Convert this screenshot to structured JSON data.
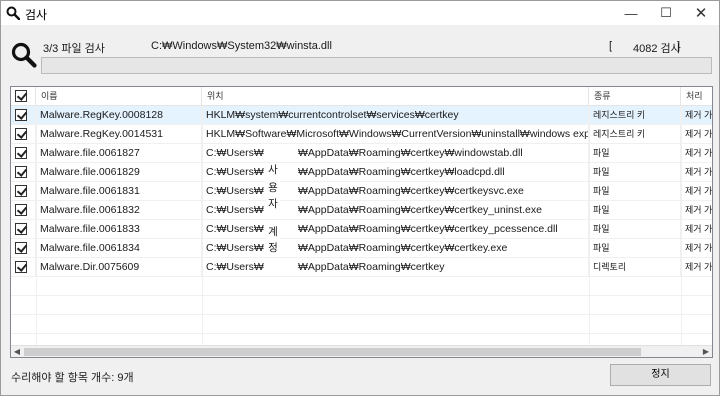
{
  "window": {
    "title": "검사",
    "min_glyph": "—",
    "max_glyph": "☐",
    "close_glyph": "✕"
  },
  "scan": {
    "progress_label": "3/3 파일 검사",
    "current_path": "C:₩Windows₩System32₩winsta.dll",
    "count_open": "[",
    "count_value": "4082 검사",
    "count_close": "]",
    "progress_percent": 0
  },
  "table": {
    "columns": [
      "이름",
      "위치",
      "종류",
      "처리"
    ],
    "rows": [
      {
        "checked": true,
        "selected": true,
        "name": "Malware.RegKey.0008128",
        "location": "HKLM₩system₩currentcontrolset₩services₩certkey",
        "type": "레지스트리 키",
        "action": "제거 가"
      },
      {
        "checked": true,
        "selected": false,
        "name": "Malware.RegKey.0014531",
        "location": "HKLM₩Software₩Microsoft₩Windows₩CurrentVersion₩uninstall₩windows explorer plu...",
        "type": "레지스트리 키",
        "action": "제거 가"
      },
      {
        "checked": true,
        "selected": false,
        "name": "Malware.file.0061827",
        "location_prefix": "C:₩Users₩",
        "location_suffix": "₩AppData₩Roaming₩certkey₩windowstab.dll",
        "type": "파일",
        "action": "제거 가"
      },
      {
        "checked": true,
        "selected": false,
        "name": "Malware.file.0061829",
        "location_prefix": "C:₩Users₩",
        "location_suffix": "₩AppData₩Roaming₩certkey₩loadcpd.dll",
        "type": "파일",
        "action": "제거 가"
      },
      {
        "checked": true,
        "selected": false,
        "name": "Malware.file.0061831",
        "location_prefix": "C:₩Users₩",
        "location_suffix": "₩AppData₩Roaming₩certkey₩certkeysvc.exe",
        "type": "파일",
        "action": "제거 가"
      },
      {
        "checked": true,
        "selected": false,
        "name": "Malware.file.0061832",
        "location_prefix": "C:₩Users₩",
        "location_suffix": "₩AppData₩Roaming₩certkey₩certkey_uninst.exe",
        "type": "파일",
        "action": "제거 가"
      },
      {
        "checked": true,
        "selected": false,
        "name": "Malware.file.0061833",
        "location_prefix": "C:₩Users₩",
        "location_suffix": "₩AppData₩Roaming₩certkey₩certkey_pcessence.dll",
        "type": "파일",
        "action": "제거 가"
      },
      {
        "checked": true,
        "selected": false,
        "name": "Malware.file.0061834",
        "location_prefix": "C:₩Users₩",
        "location_suffix": "₩AppData₩Roaming₩certkey₩certkey.exe",
        "type": "파일",
        "action": "제거 가"
      },
      {
        "checked": true,
        "selected": false,
        "name": "Malware.Dir.0075609",
        "location_prefix": "C:₩Users₩",
        "location_suffix": "₩AppData₩Roaming₩certkey",
        "type": "디렉토리",
        "action": "제거 가"
      }
    ],
    "user_overlay": [
      "사",
      "용",
      "자",
      "계",
      "정"
    ]
  },
  "footer": {
    "items_to_fix": "수리해야 할 항목 개수: 9개",
    "stop_label": "정지"
  },
  "colors": {
    "selected_row": "#e5f3ff",
    "progress": "#06b025"
  }
}
